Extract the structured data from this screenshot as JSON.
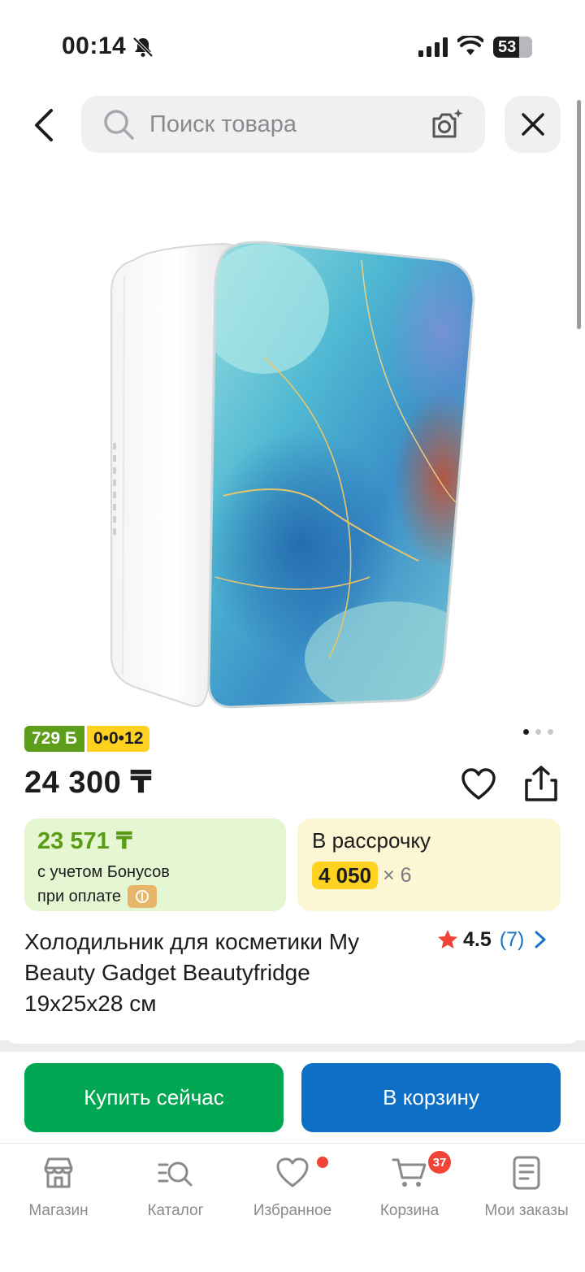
{
  "status_bar": {
    "time": "00:14",
    "battery": "53"
  },
  "header": {
    "search_placeholder": "Поиск товара"
  },
  "product": {
    "bonus_badge": "729 Б",
    "installment_badge": "0•0•12",
    "price": "24 300 ₸",
    "image_count": 3,
    "image_active_index": 0,
    "title": "Холодильник для косметики My Beauty Gadget Beautyfridge 19x25x28 см",
    "rating": "4.5",
    "reviews": "(7)"
  },
  "bonus_card": {
    "price": "23 571 ₸",
    "line1": "с учетом Бонусов",
    "line2": "при оплате"
  },
  "installment_card": {
    "title": "В рассрочку",
    "amount": "4 050",
    "multiplier": "× 6"
  },
  "actions": {
    "buy_now": "Купить сейчас",
    "add_to_cart": "В корзину"
  },
  "tabbar": {
    "items": [
      {
        "label": "Магазин",
        "icon": "shop-icon"
      },
      {
        "label": "Каталог",
        "icon": "catalog-search-icon"
      },
      {
        "label": "Избранное",
        "icon": "heart-icon"
      },
      {
        "label": "Корзина",
        "icon": "cart-icon"
      },
      {
        "label": "Мои заказы",
        "icon": "orders-icon"
      }
    ],
    "cart_count": "37"
  },
  "colors": {
    "buy_green": "#00a651",
    "cart_blue": "#0d6fc5",
    "bonus_green": "#5c9e1a",
    "installment_yellow": "#ffd21f",
    "badge_red": "#f04438",
    "rating_blue": "#1a73c9"
  }
}
